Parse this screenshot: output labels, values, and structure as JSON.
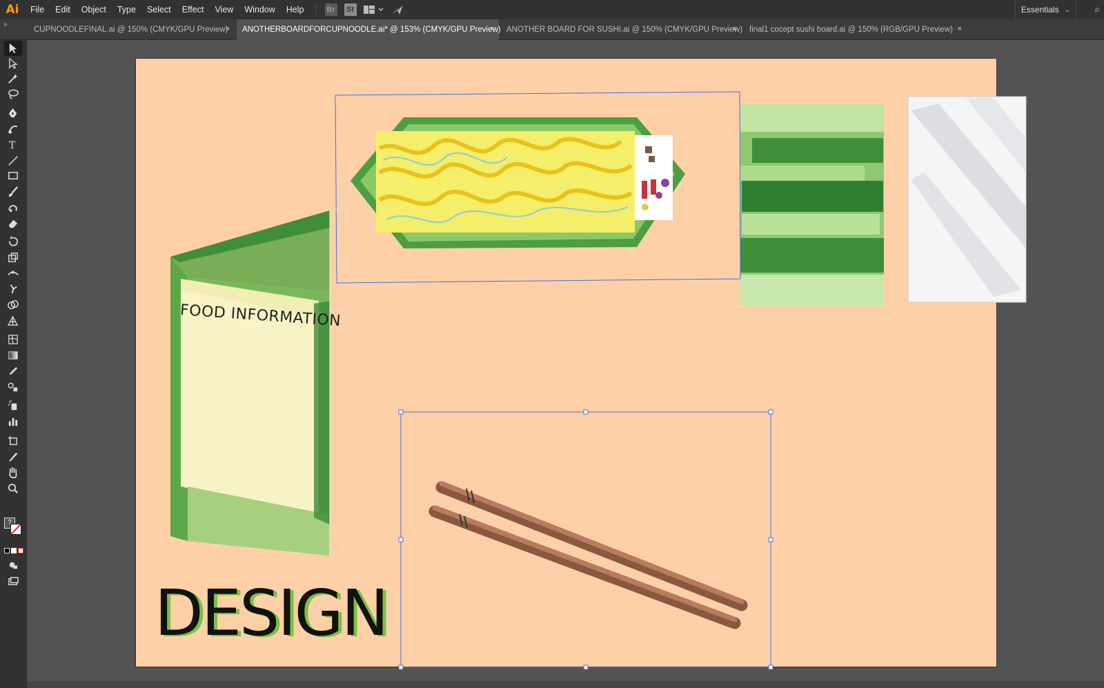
{
  "app": {
    "logo": "Ai"
  },
  "menu": {
    "items": [
      "File",
      "Edit",
      "Object",
      "Type",
      "Select",
      "Effect",
      "View",
      "Window",
      "Help"
    ],
    "bridge_icon": "Br",
    "stock_icon": "St"
  },
  "workspace": {
    "label": "Essentials"
  },
  "tabs": [
    {
      "label": "CUPNOODLEFINAL.ai @ 150% (CMYK/GPU Preview)",
      "close": "×",
      "active": false
    },
    {
      "label": "ANOTHERBOARDFORCUPNOODLE.ai* @ 153% (CMYK/GPU Preview)",
      "close": "×",
      "active": true
    },
    {
      "label": "ANOTHER BOARD FOR SUSHI.ai @ 150% (CMYK/GPU Preview)",
      "close": "×",
      "active": false
    },
    {
      "label": "final1 cocept sushi board.ai @ 150% (RGB/GPU Preview)",
      "close": "×",
      "active": false
    }
  ],
  "artboard": {
    "background": "#fdd0a7",
    "food_label": "FOOD INFORMATION",
    "title": "DESIGN",
    "title_color": "#111111",
    "title_shadow_color": "#7bc142"
  },
  "colors": {
    "selection": "#4a6ee0",
    "tab_active": "#535353",
    "chrome_dark": "#323232",
    "logo": "#ff9a00"
  },
  "tools": [
    "selection-tool-icon",
    "direct-selection-tool-icon",
    "magic-wand-tool-icon",
    "lasso-tool-icon",
    "pen-tool-icon",
    "curvature-tool-icon",
    "type-tool-icon",
    "line-segment-tool-icon",
    "rectangle-tool-icon",
    "paintbrush-tool-icon",
    "shaper-tool-icon",
    "eraser-tool-icon",
    "rotate-tool-icon",
    "scale-tool-icon",
    "width-tool-icon",
    "puppet-warp-tool-icon",
    "shape-builder-tool-icon",
    "perspective-grid-tool-icon",
    "mesh-tool-icon",
    "gradient-tool-icon",
    "eyedropper-tool-icon",
    "blend-tool-icon",
    "symbol-sprayer-tool-icon",
    "column-graph-tool-icon",
    "artboard-tool-icon",
    "slice-tool-icon",
    "hand-tool-icon",
    "zoom-tool-icon"
  ],
  "fill_stroke": {
    "help_mark": "?"
  }
}
